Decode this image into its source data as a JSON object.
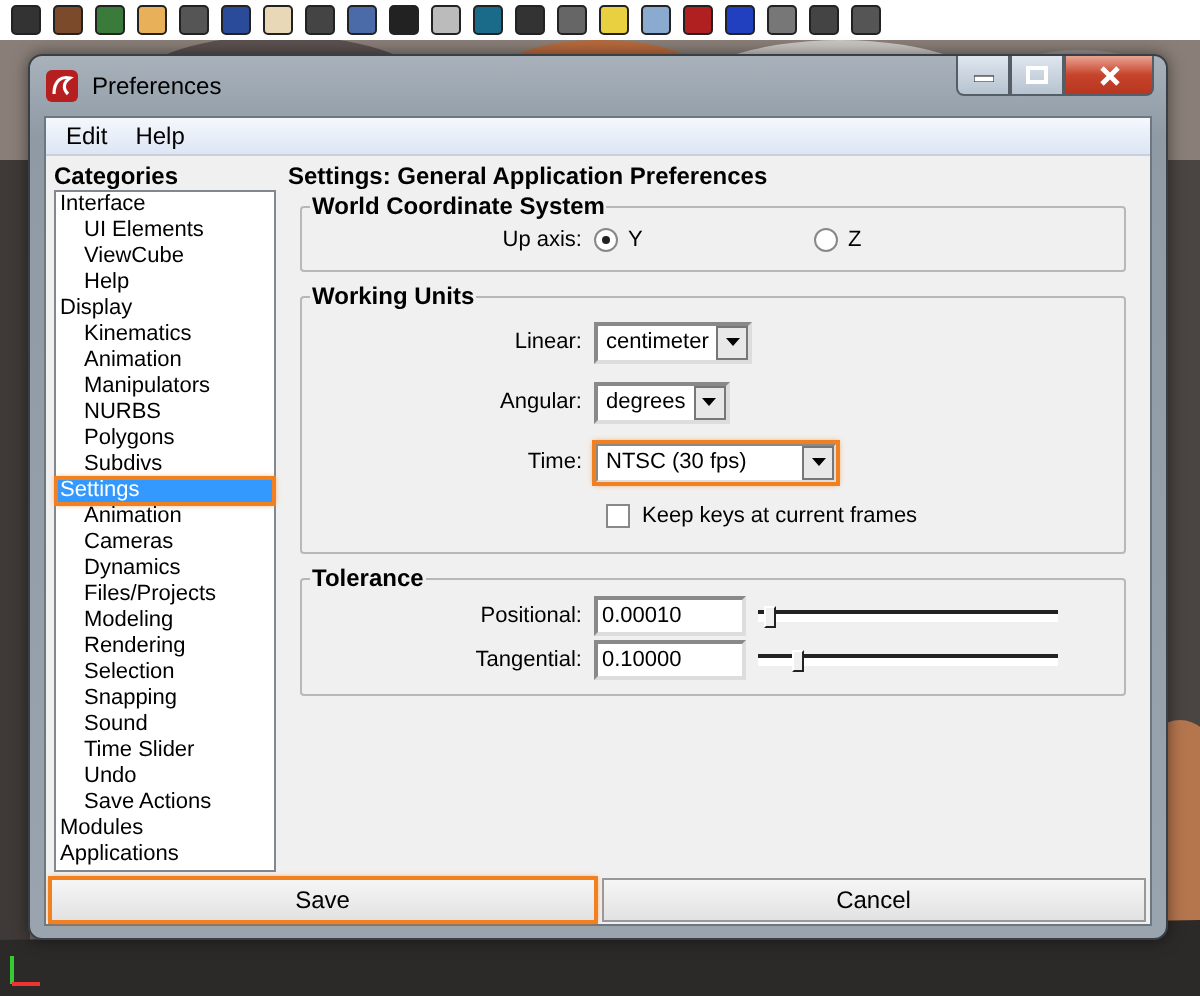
{
  "window": {
    "title": "Preferences"
  },
  "menu": [
    {
      "label": "Edit"
    },
    {
      "label": "Help"
    }
  ],
  "categories": {
    "title": "Categories",
    "items": [
      {
        "label": "Interface",
        "selected": false,
        "highlighted": false,
        "children": [
          {
            "label": "UI Elements",
            "selected": false,
            "highlighted": false
          },
          {
            "label": "ViewCube",
            "selected": false,
            "highlighted": false
          },
          {
            "label": "Help",
            "selected": false,
            "highlighted": false
          }
        ]
      },
      {
        "label": "Display",
        "selected": false,
        "highlighted": false,
        "children": [
          {
            "label": "Kinematics",
            "selected": false,
            "highlighted": false
          },
          {
            "label": "Animation",
            "selected": false,
            "highlighted": false
          },
          {
            "label": "Manipulators",
            "selected": false,
            "highlighted": false
          },
          {
            "label": "NURBS",
            "selected": false,
            "highlighted": false
          },
          {
            "label": "Polygons",
            "selected": false,
            "highlighted": false
          },
          {
            "label": "Subdivs",
            "selected": false,
            "highlighted": false
          }
        ]
      },
      {
        "label": "Settings",
        "selected": true,
        "highlighted": true,
        "children": [
          {
            "label": "Animation",
            "selected": false,
            "highlighted": false
          },
          {
            "label": "Cameras",
            "selected": false,
            "highlighted": false
          },
          {
            "label": "Dynamics",
            "selected": false,
            "highlighted": false
          },
          {
            "label": "Files/Projects",
            "selected": false,
            "highlighted": false
          },
          {
            "label": "Modeling",
            "selected": false,
            "highlighted": false
          },
          {
            "label": "Rendering",
            "selected": false,
            "highlighted": false
          },
          {
            "label": "Selection",
            "selected": false,
            "highlighted": false
          },
          {
            "label": "Snapping",
            "selected": false,
            "highlighted": false
          },
          {
            "label": "Sound",
            "selected": false,
            "highlighted": false
          },
          {
            "label": "Time Slider",
            "selected": false,
            "highlighted": false
          },
          {
            "label": "Undo",
            "selected": false,
            "highlighted": false
          },
          {
            "label": "Save Actions",
            "selected": false,
            "highlighted": false
          }
        ]
      },
      {
        "label": "Modules",
        "selected": false,
        "highlighted": false
      },
      {
        "label": "Applications",
        "selected": false,
        "highlighted": false
      }
    ]
  },
  "heading": "Settings: General Application Preferences",
  "world_coordinate_system": {
    "title": "World Coordinate System",
    "label": "Up axis:",
    "options": [
      {
        "label": "Y",
        "selected": true
      },
      {
        "label": "Z",
        "selected": false
      }
    ]
  },
  "working_units": {
    "title": "Working Units",
    "fields": [
      {
        "label": "Linear:",
        "value": "centimeter",
        "highlighted": false
      },
      {
        "label": "Angular:",
        "value": "degrees",
        "highlighted": false
      },
      {
        "label": "Time:",
        "value": "NTSC (30 fps)",
        "highlighted": true
      }
    ],
    "checkbox": {
      "label": "Keep keys at current frames",
      "checked": false
    }
  },
  "tolerance": {
    "title": "Tolerance",
    "rows": [
      {
        "label": "Positional:",
        "value": "0.00010",
        "level": 0.02
      },
      {
        "label": "Tangential:",
        "value": "0.10000",
        "level": 0.12
      }
    ]
  },
  "buttons": [
    {
      "label": "Save",
      "highlighted": true
    },
    {
      "label": "Cancel",
      "highlighted": false
    }
  ]
}
